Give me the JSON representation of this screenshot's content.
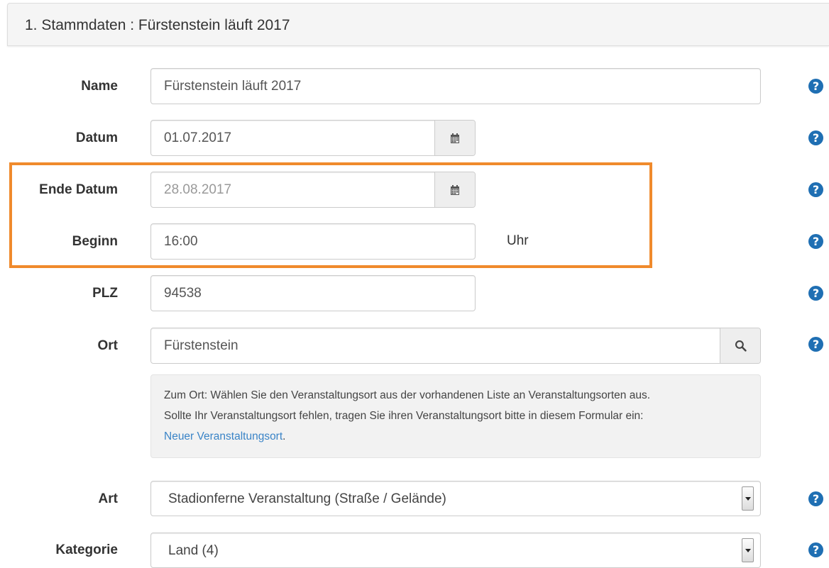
{
  "panel": {
    "title": "1. Stammdaten : Fürstenstein läuft 2017"
  },
  "form": {
    "name": {
      "label": "Name",
      "value": "Fürstenstein läuft 2017"
    },
    "datum": {
      "label": "Datum",
      "value": "01.07.2017"
    },
    "ende_datum": {
      "label": "Ende Datum",
      "value": "28.08.2017"
    },
    "beginn": {
      "label": "Beginn",
      "value": "16:00",
      "unit": "Uhr"
    },
    "plz": {
      "label": "PLZ",
      "value": "94538"
    },
    "ort": {
      "label": "Ort",
      "value": "Fürstenstein"
    },
    "ort_info": {
      "line1": "Zum Ort: Wählen Sie den Veranstaltungsort aus der vorhandenen Liste an Veranstaltungsorten aus.",
      "line2": "Sollte Ihr Veranstaltungsort fehlen, tragen Sie ihren Veranstaltungsort bitte in diesem Formular ein:",
      "link": "Neuer Veranstaltungsort",
      "link_suffix": "."
    },
    "art": {
      "label": "Art",
      "value": "Stadionferne Veranstaltung (Straße / Gelände)"
    },
    "kategorie": {
      "label": "Kategorie",
      "value": "Land (4)"
    },
    "help_glyph": "?"
  },
  "colors": {
    "highlight": "#f08a2c",
    "help_icon": "#1f6fb3",
    "link": "#3a84c7"
  },
  "icons": {
    "calendar": "calendar-icon",
    "search": "search-icon",
    "help": "question-circle-icon",
    "dropdown": "chevron-down-icon"
  }
}
